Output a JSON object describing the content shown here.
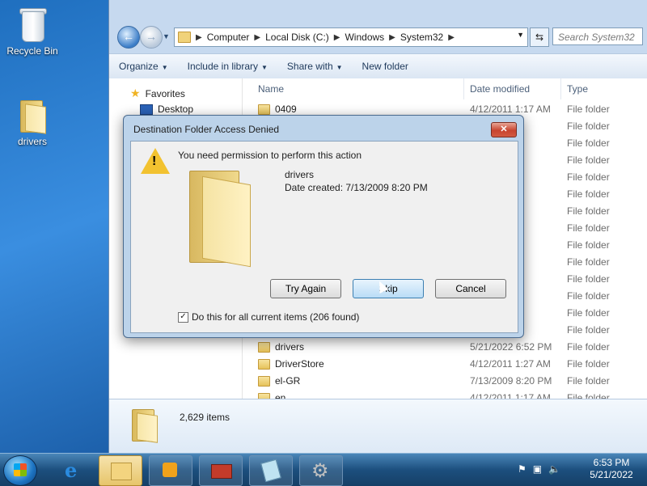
{
  "desktop": {
    "icons": [
      {
        "label": "Recycle Bin"
      },
      {
        "label": "drivers"
      }
    ]
  },
  "explorer": {
    "breadcrumb": [
      "Computer",
      "Local Disk (C:)",
      "Windows",
      "System32"
    ],
    "search_placeholder": "Search System32",
    "toolbar": {
      "organize": "Organize",
      "include": "Include in library",
      "share": "Share with",
      "new_folder": "New folder"
    },
    "nav": {
      "favorites": "Favorites",
      "desktop": "Desktop"
    },
    "columns": {
      "name": "Name",
      "date": "Date modified",
      "type": "Type"
    },
    "rows": [
      {
        "name": "0409",
        "date": "4/12/2011 1:17 AM",
        "type": "File folder"
      },
      {
        "name": "",
        "date": "30 PM",
        "type": "File folder"
      },
      {
        "name": "",
        "date": "20 PM",
        "type": "File folder"
      },
      {
        "name": "",
        "date": "20 PM",
        "type": "File folder"
      },
      {
        "name": "",
        "date": "17 AM",
        "type": "File folder"
      },
      {
        "name": "",
        "date": "23 PM",
        "type": "File folder"
      },
      {
        "name": "",
        "date": "24 PM",
        "type": "File folder"
      },
      {
        "name": "",
        "date": "20 PM",
        "type": "File folder"
      },
      {
        "name": "",
        "date": "17 AM",
        "type": "File folder"
      },
      {
        "name": "",
        "date": "17 PM",
        "type": "File folder"
      },
      {
        "name": "",
        "date": "30 PM",
        "type": "File folder"
      },
      {
        "name": "",
        "date": "30 PM",
        "type": "File folder"
      },
      {
        "name": "",
        "date": "20 PM",
        "type": "File folder"
      },
      {
        "name": "",
        "date": "17 AM",
        "type": "File folder"
      },
      {
        "name": "drivers",
        "date": "5/21/2022 6:52 PM",
        "type": "File folder"
      },
      {
        "name": "DriverStore",
        "date": "4/12/2011 1:27 AM",
        "type": "File folder"
      },
      {
        "name": "el-GR",
        "date": "7/13/2009 8:20 PM",
        "type": "File folder"
      },
      {
        "name": "en",
        "date": "4/12/2011 1:17 AM",
        "type": "File folder"
      }
    ],
    "status": {
      "count": "2,629 items"
    }
  },
  "dialog": {
    "title": "Destination Folder Access Denied",
    "close": "✕",
    "message": "You need permission to perform this action",
    "folder_name": "drivers",
    "folder_date": "Date created: 7/13/2009 8:20 PM",
    "buttons": {
      "try_again": "Try Again",
      "skip": "Skip",
      "cancel": "Cancel"
    },
    "checkbox_label": "Do this for all current items (206 found)",
    "checkbox_checked": true
  },
  "taskbar": {
    "clock_time": "6:53 PM",
    "clock_date": "5/21/2022"
  }
}
